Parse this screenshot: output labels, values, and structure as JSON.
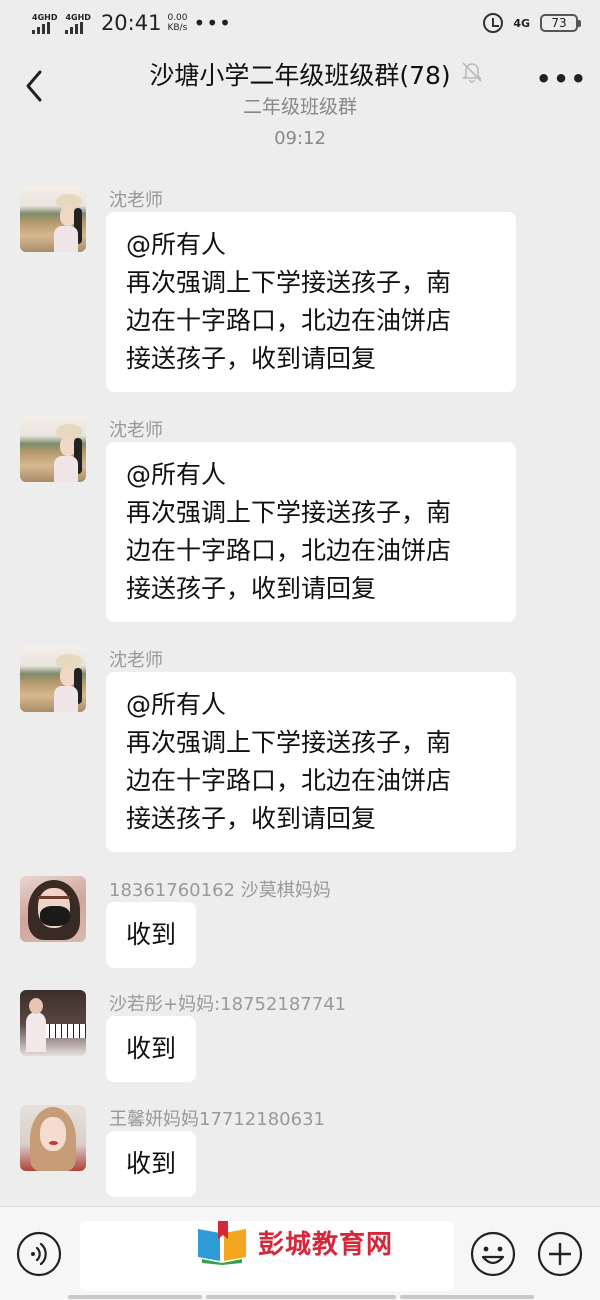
{
  "status_bar": {
    "network_1": "4GHD",
    "network_2": "4GHD",
    "time": "20:41",
    "speed_value": "0.00",
    "speed_unit": "KB/s",
    "dots": "•••",
    "network_right": "4G",
    "battery": "73"
  },
  "header": {
    "title": "沙塘小学二年级班级群(78)",
    "subtitle": "二年级班级群",
    "more": "•••"
  },
  "timestamp": "09:12",
  "messages": [
    {
      "sender": "沈老师",
      "lines": [
        "@所有人",
        "再次强调上下学接送孩子，南",
        "边在十字路口，北边在油饼店",
        "接送孩子，收到请回复"
      ]
    },
    {
      "sender": "沈老师",
      "lines": [
        "@所有人",
        "再次强调上下学接送孩子，南",
        "边在十字路口，北边在油饼店",
        "接送孩子，收到请回复"
      ]
    },
    {
      "sender": "沈老师",
      "lines": [
        "@所有人",
        "再次强调上下学接送孩子，南",
        "边在十字路口，北边在油饼店",
        "接送孩子，收到请回复"
      ]
    },
    {
      "sender": "18361760162  沙莫棋妈妈",
      "text": "收到"
    },
    {
      "sender": "沙若彤+妈妈:18752187741",
      "text": "收到"
    },
    {
      "sender": "王馨妍妈妈17712180631",
      "text": "收到"
    }
  ],
  "composer": {
    "input_value": ""
  },
  "watermark": {
    "text": "彭城教育网"
  },
  "icons": {
    "back": "back-icon",
    "mute": "bell-off-icon",
    "more": "more-icon",
    "voice": "voice-icon",
    "emoji": "emoji-icon",
    "plus": "plus-icon"
  },
  "colors": {
    "background": "#ededed",
    "bubble": "#ffffff",
    "watermark_red": "#d6263a"
  }
}
